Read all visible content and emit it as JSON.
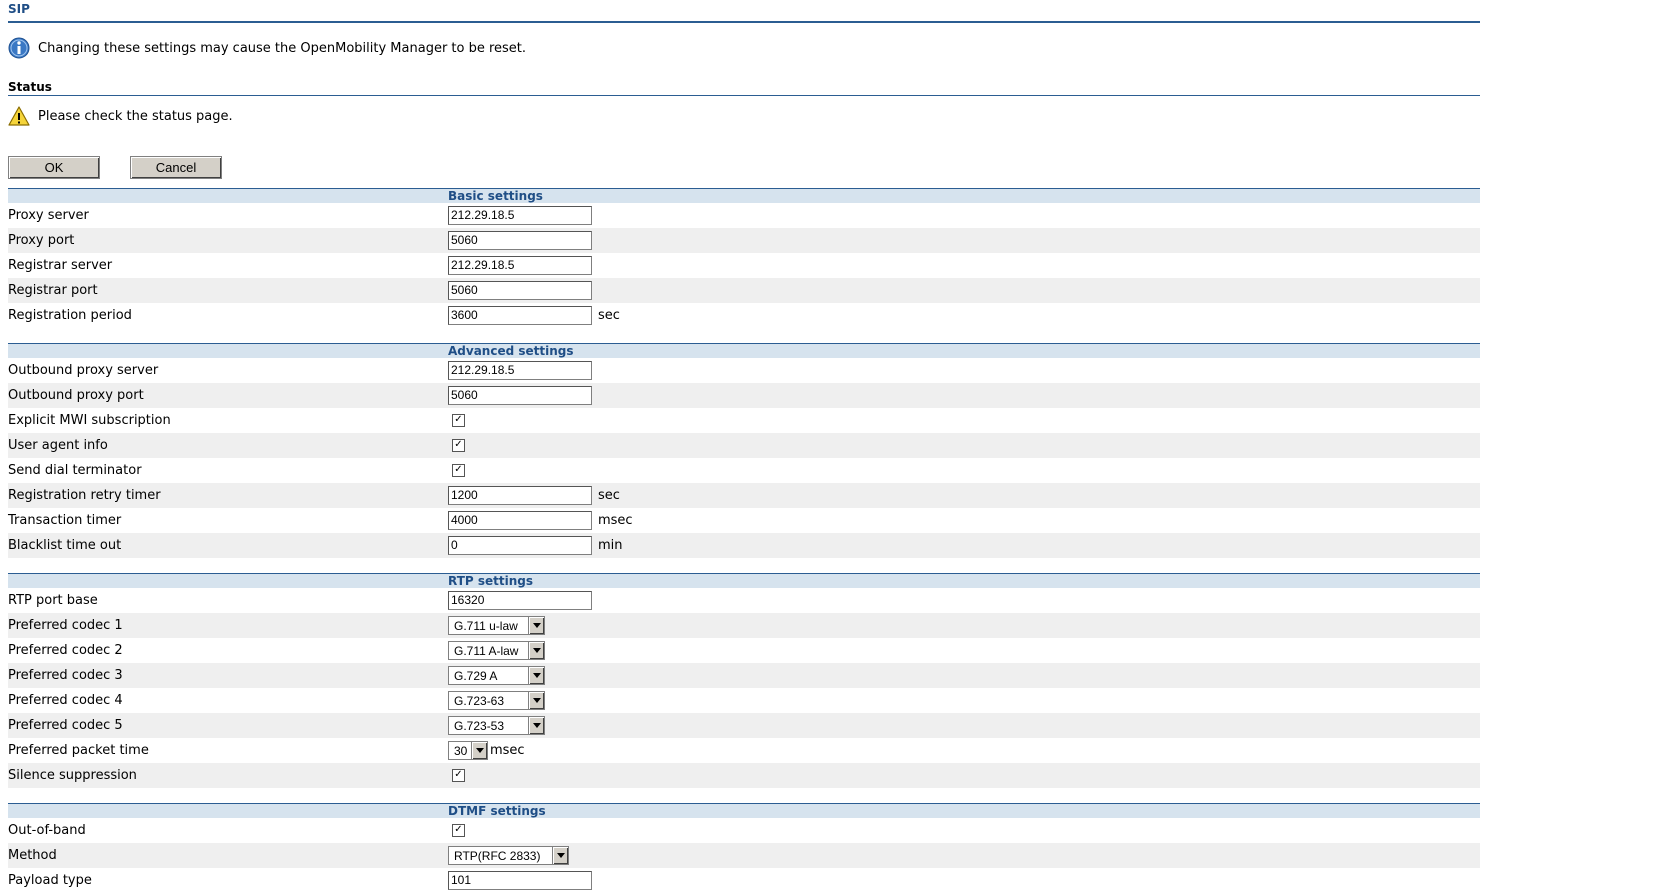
{
  "page": {
    "title": "SIP",
    "info_message": "Changing these settings may cause the OpenMobility Manager to be reset.",
    "status_title": "Status",
    "status_message": "Please check the status page.",
    "ok_label": "OK",
    "cancel_label": "Cancel",
    "colors": {
      "accent": "#2b5d92",
      "header_bg": "#d6e3ee",
      "row_alt": "#efefef"
    }
  },
  "basic": {
    "title": "Basic settings",
    "proxy_server": {
      "label": "Proxy server",
      "value": "212.29.18.5"
    },
    "proxy_port": {
      "label": "Proxy port",
      "value": "5060"
    },
    "registrar_server": {
      "label": "Registrar server",
      "value": "212.29.18.5"
    },
    "registrar_port": {
      "label": "Registrar port",
      "value": "5060"
    },
    "registration_period": {
      "label": "Registration period",
      "value": "3600",
      "unit": "sec"
    }
  },
  "advanced": {
    "title": "Advanced settings",
    "outbound_proxy_server": {
      "label": "Outbound proxy server",
      "value": "212.29.18.5"
    },
    "outbound_proxy_port": {
      "label": "Outbound proxy port",
      "value": "5060"
    },
    "explicit_mwi": {
      "label": "Explicit MWI subscription",
      "checked": true
    },
    "user_agent_info": {
      "label": "User agent info",
      "checked": true
    },
    "send_dial_terminator": {
      "label": "Send dial terminator",
      "checked": true
    },
    "registration_retry_timer": {
      "label": "Registration retry timer",
      "value": "1200",
      "unit": "sec"
    },
    "transaction_timer": {
      "label": "Transaction timer",
      "value": "4000",
      "unit": "msec"
    },
    "blacklist_timeout": {
      "label": "Blacklist time out",
      "value": "0",
      "unit": "min"
    }
  },
  "rtp": {
    "title": "RTP settings",
    "port_base": {
      "label": "RTP port base",
      "value": "16320"
    },
    "codec1": {
      "label": "Preferred codec 1",
      "value": "G.711 u-law"
    },
    "codec2": {
      "label": "Preferred codec 2",
      "value": "G.711 A-law"
    },
    "codec3": {
      "label": "Preferred codec 3",
      "value": "G.729 A"
    },
    "codec4": {
      "label": "Preferred codec 4",
      "value": "G.723-63"
    },
    "codec5": {
      "label": "Preferred codec 5",
      "value": "G.723-53"
    },
    "packet_time": {
      "label": "Preferred packet time",
      "value": "30",
      "unit": "msec"
    },
    "silence_suppression": {
      "label": "Silence suppression",
      "checked": true
    }
  },
  "dtmf": {
    "title": "DTMF settings",
    "out_of_band": {
      "label": "Out-of-band",
      "checked": true
    },
    "method": {
      "label": "Method",
      "value": "RTP(RFC 2833)"
    },
    "payload_type": {
      "label": "Payload type",
      "value": "101"
    }
  },
  "icons": {
    "info": "info-icon",
    "warning": "warning-icon",
    "check": "✓"
  }
}
